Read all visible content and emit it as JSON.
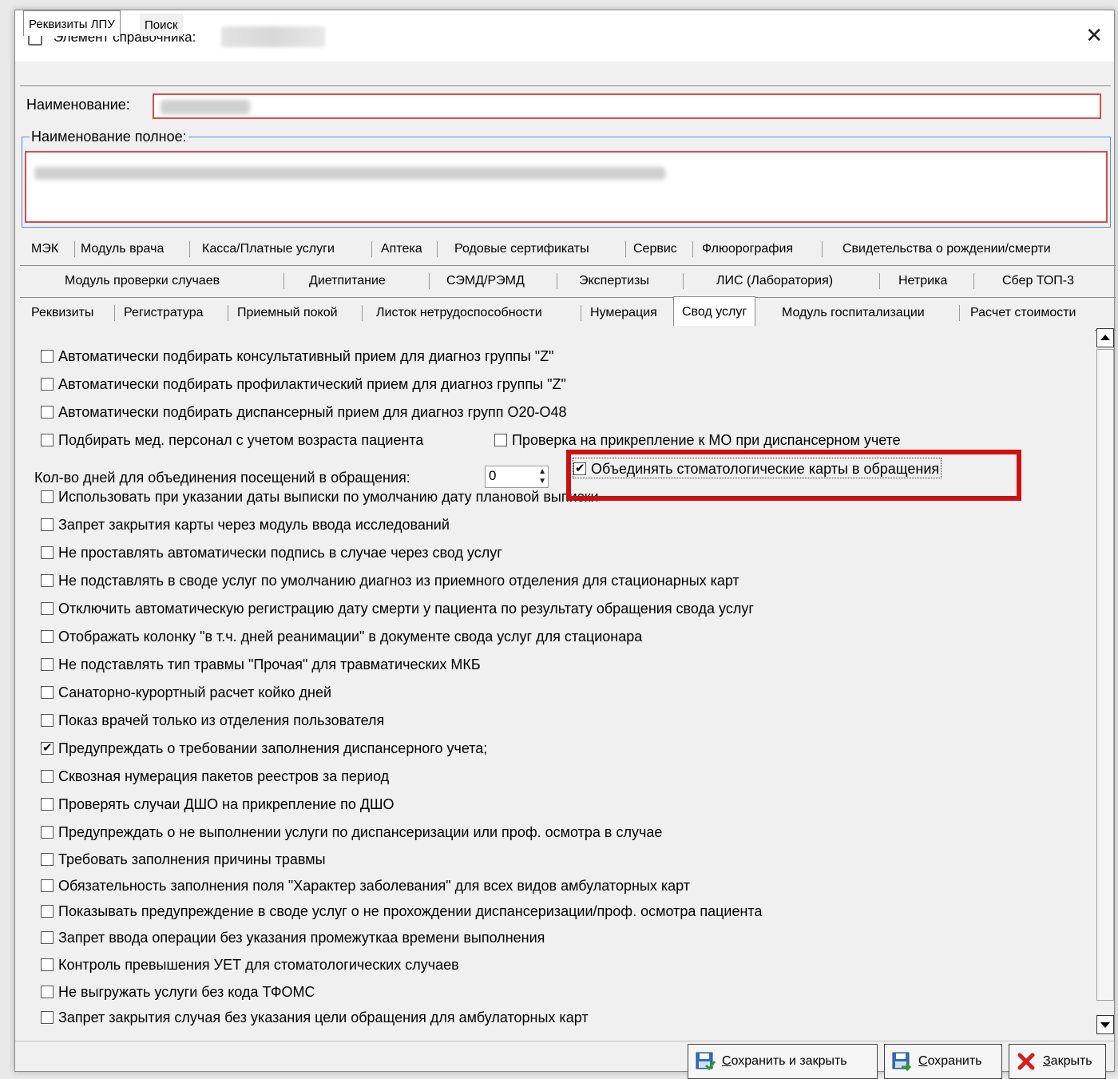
{
  "window": {
    "title": "Элемент справочника:",
    "close_glyph": "✕"
  },
  "top_tabs": [
    "Реквизиты ЛПУ",
    "Поиск"
  ],
  "fields": {
    "name_label": "Наименование:",
    "fullname_label": "Наименование полное:"
  },
  "tab_rows": [
    [
      "МЭК",
      "Модуль врача",
      "Касса/Платные услуги",
      "Аптека",
      "Родовые сертификаты",
      "Сервис",
      "Флюорография",
      "Свидетельства о рождении/смерти"
    ],
    [
      "Модуль проверки случаев",
      "Диетпитание",
      "СЭМД/РЭМД",
      "Экспертизы",
      "ЛИС (Лаборатория)",
      "Нетрика",
      "Сбер ТОП-3"
    ],
    [
      "Реквизиты",
      "Регистратура",
      "Приемный покой",
      "Листок нетрудоспособности",
      "Нумерация",
      "Свод услуг",
      "Модуль госпитализации",
      "Расчет стоимости"
    ]
  ],
  "active_tab": "Свод услуг",
  "options_top": [
    {
      "label": "Автоматически подбирать консультативный прием для диагноз группы \"Z\"",
      "checked": false
    },
    {
      "label": "Автоматически подбирать профилактический прием для диагноз группы \"Z\"",
      "checked": false
    },
    {
      "label": "Автоматически подбирать диспансерный прием для диагноз групп O20-O48",
      "checked": false
    },
    {
      "label": "Подбирать мед. персонал с учетом возраста пациента",
      "checked": false
    }
  ],
  "option_inline": {
    "label": "Проверка на прикрепление к МО при диспансерном учете",
    "checked": false
  },
  "days": {
    "label": "Кол-во дней для объединения посещений в обращения:",
    "value": "0"
  },
  "dental_merge": {
    "label": "Объединять стоматологические карты в обращения",
    "checked": true
  },
  "options_bottom": [
    {
      "label": "Использовать при указании даты выписки по умолчанию дату плановой выписки",
      "checked": false
    },
    {
      "label": "Запрет закрытия карты через модуль ввода исследований",
      "checked": false
    },
    {
      "label": "Не проставлять автоматически подпись в случае через свод услуг",
      "checked": false
    },
    {
      "label": "Не подставлять в своде услуг по умолчанию диагноз из приемного отделения для стационарных карт",
      "checked": false
    },
    {
      "label": "Отключить автоматическую регистрацию дату смерти у пациента по результату обращения свода услуг",
      "checked": false
    },
    {
      "label": "Отображать колонку \"в т.ч. дней реанимации\" в документе свода услуг для стационара",
      "checked": false
    },
    {
      "label": "Не подставлять тип травмы \"Прочая\" для травматических МКБ",
      "checked": false
    },
    {
      "label": "Санаторно-курортный расчет койко дней",
      "checked": false
    },
    {
      "label": "Показ врачей только из отделения пользователя",
      "checked": false
    },
    {
      "label": "Предупреждать о требовании заполнения диспансерного учета;",
      "checked": true
    },
    {
      "label": "Сквозная нумерация пакетов реестров за период",
      "checked": false
    },
    {
      "label": "Проверять случаи ДШО на прикрепление по ДШО",
      "checked": false
    },
    {
      "label": "Предупреждать о не выполнении услуги по диспансеризации или проф. осмотра в случае",
      "checked": false
    },
    {
      "label": "Требовать заполнения причины травмы",
      "checked": false
    },
    {
      "label": "Обязательность заполнения поля \"Характер заболевания\" для всех видов амбулаторных карт",
      "checked": false
    },
    {
      "label": "Показывать предупреждение в своде услуг о не прохождении диспансеризации/проф. осмотра пациента",
      "checked": false
    },
    {
      "label": "Запрет ввода операции без указания промежуткаа времени выполнения",
      "checked": false
    },
    {
      "label": "Контроль превышения УЕТ для стоматологических случаев",
      "checked": false
    },
    {
      "label": "Не выгружать услуги без кода ТФОМС",
      "checked": false
    },
    {
      "label": "Запрет закрытия случая без указания цели обращения для амбулаторных карт",
      "checked": false
    }
  ],
  "buttons": {
    "save_close": {
      "accel": "С",
      "rest": "охранить и закрыть"
    },
    "save": {
      "accel": "С",
      "rest": "охранить"
    },
    "close": {
      "accel": "З",
      "rest": "акрыть"
    }
  },
  "colors": {
    "highlight": "#cc1111",
    "invalid_border": "#e04b4b",
    "fieldset_border": "#4d8fd6"
  },
  "icons": {
    "title": "clipboard-icon",
    "save_close": "save-close-icon",
    "save": "save-icon",
    "close": "red-x-icon"
  }
}
